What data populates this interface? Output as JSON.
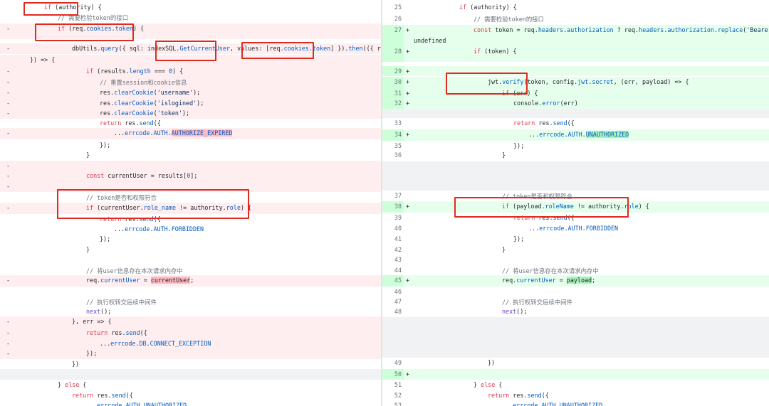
{
  "diff": {
    "left": {
      "rows": [
        {
          "text": "if (authority) {",
          "marker": "",
          "type": "normal"
        },
        {
          "text": "// 需要检验token的接口",
          "marker": "",
          "type": "normal"
        },
        {
          "text": "if (req.cookies.token) {",
          "marker": "-",
          "type": "del"
        },
        {
          "text": "dbUtils.query({ sql: indexSQL.GetCurrentUser, values: [req.cookies.token] }).then(({ results",
          "marker": "-",
          "type": "del"
        },
        {
          "text": "}) => {",
          "marker": "",
          "type": "del"
        },
        {
          "text": "if (results.length === 0) {",
          "marker": "-",
          "type": "del"
        },
        {
          "text": "// 重置session和cookie信息",
          "marker": "-",
          "type": "del"
        },
        {
          "text": "res.clearCookie('username');",
          "marker": "-",
          "type": "del"
        },
        {
          "text": "res.clearCookie('islogined');",
          "marker": "-",
          "type": "del"
        },
        {
          "text": "res.clearCookie('token');",
          "marker": "-",
          "type": "del"
        },
        {
          "text": "return res.send({",
          "marker": "",
          "type": "normal"
        },
        {
          "text": "...errcode.AUTH.AUTHORIZE_EXPIRED",
          "marker": "-",
          "type": "del"
        },
        {
          "text": "});",
          "marker": "",
          "type": "normal"
        },
        {
          "text": "}",
          "marker": "",
          "type": "normal"
        },
        {
          "text": "",
          "marker": "-",
          "type": "del"
        },
        {
          "text": "const currentUser = results[0];",
          "marker": "-",
          "type": "del"
        },
        {
          "text": "",
          "marker": "-",
          "type": "del"
        },
        {
          "text": "// token是否和权限符合",
          "marker": "",
          "type": "normal"
        },
        {
          "text": "if (currentUser.role_name != authority.role) {",
          "marker": "-",
          "type": "del"
        },
        {
          "text": "return res.send({",
          "marker": "",
          "type": "normal"
        },
        {
          "text": "...errcode.AUTH.FORBIDDEN",
          "marker": "",
          "type": "normal"
        },
        {
          "text": "});",
          "marker": "",
          "type": "normal"
        },
        {
          "text": "}",
          "marker": "",
          "type": "normal"
        },
        {
          "text": "",
          "marker": "",
          "type": "normal"
        },
        {
          "text": "// 将user信息存在本次请求内存中",
          "marker": "",
          "type": "normal"
        },
        {
          "text": "req.currentUser = currentUser;",
          "marker": "-",
          "type": "del"
        },
        {
          "text": "",
          "marker": "",
          "type": "normal"
        },
        {
          "text": "// 执行权转交后续中间件",
          "marker": "",
          "type": "normal"
        },
        {
          "text": "next();",
          "marker": "",
          "type": "normal"
        },
        {
          "text": "}, err => {",
          "marker": "-",
          "type": "del"
        },
        {
          "text": "return res.send({",
          "marker": "-",
          "type": "del"
        },
        {
          "text": "...errcode.DB.CONNECT_EXCEPTION",
          "marker": "-",
          "type": "del"
        },
        {
          "text": "});",
          "marker": "-",
          "type": "del"
        },
        {
          "text": "})",
          "marker": "",
          "type": "normal"
        },
        {
          "text": "",
          "marker": "",
          "type": "fill"
        },
        {
          "text": "} else {",
          "marker": "",
          "type": "normal"
        },
        {
          "text": "return res.send({",
          "marker": "",
          "type": "normal"
        },
        {
          "text": "...errcode.AUTH.UNAUTHORIZED",
          "marker": "",
          "type": "normal"
        }
      ]
    },
    "right": {
      "rows": [
        {
          "line": "25",
          "marker": "",
          "text": "if (authority) {",
          "type": "normal"
        },
        {
          "line": "26",
          "marker": "",
          "text": "// 需要检验token的接口",
          "type": "normal"
        },
        {
          "line": "27",
          "marker": "+",
          "text": "const token = req.headers.authorization ? req.headers.authorization.replace('Bearer ', '') :",
          "wrap": "undefined",
          "type": "add"
        },
        {
          "line": "28",
          "marker": "+",
          "text": "if (token) {",
          "type": "add"
        },
        {
          "line": "29",
          "marker": "+",
          "text": "",
          "type": "add"
        },
        {
          "line": "30",
          "marker": "+",
          "text": "jwt.verify(token, config.jwt.secret, (err, payload) => {",
          "type": "add"
        },
        {
          "line": "31",
          "marker": "+",
          "text": "if (err) {",
          "type": "add"
        },
        {
          "line": "32",
          "marker": "+",
          "text": "console.error(err)",
          "type": "add"
        },
        {
          "line": "",
          "marker": "",
          "text": "",
          "type": "fill"
        },
        {
          "line": "33",
          "marker": "",
          "text": "return res.send({",
          "type": "normal"
        },
        {
          "line": "34",
          "marker": "+",
          "text": "...errcode.AUTH.UNAUTHORIZED",
          "type": "add"
        },
        {
          "line": "35",
          "marker": "",
          "text": "});",
          "type": "normal"
        },
        {
          "line": "36",
          "marker": "",
          "text": "}",
          "type": "normal"
        },
        {
          "line": "",
          "marker": "",
          "text": "",
          "type": "fill"
        },
        {
          "line": "37",
          "marker": "",
          "text": "// token是否和权限符合",
          "type": "normal"
        },
        {
          "line": "38",
          "marker": "+",
          "text": "if (payload.roleName != authority.role) {",
          "type": "add"
        },
        {
          "line": "39",
          "marker": "",
          "text": "return res.send({",
          "type": "normal"
        },
        {
          "line": "40",
          "marker": "",
          "text": "...errcode.AUTH.FORBIDDEN",
          "type": "normal"
        },
        {
          "line": "41",
          "marker": "",
          "text": "});",
          "type": "normal"
        },
        {
          "line": "42",
          "marker": "",
          "text": "}",
          "type": "normal"
        },
        {
          "line": "43",
          "marker": "",
          "text": "",
          "type": "normal"
        },
        {
          "line": "44",
          "marker": "",
          "text": "// 将user信息存在本次请求内存中",
          "type": "normal"
        },
        {
          "line": "45",
          "marker": "+",
          "text": "req.currentUser = payload;",
          "type": "add"
        },
        {
          "line": "46",
          "marker": "",
          "text": "",
          "type": "normal"
        },
        {
          "line": "47",
          "marker": "",
          "text": "// 执行权转交后续中间件",
          "type": "normal"
        },
        {
          "line": "48",
          "marker": "",
          "text": "next();",
          "type": "normal"
        },
        {
          "line": "",
          "marker": "",
          "text": "",
          "type": "fill"
        },
        {
          "line": "49",
          "marker": "",
          "text": "})",
          "type": "normal"
        },
        {
          "line": "50",
          "marker": "+",
          "text": "",
          "type": "add"
        },
        {
          "line": "51",
          "marker": "",
          "text": "} else {",
          "type": "normal"
        },
        {
          "line": "52",
          "marker": "",
          "text": "return res.send({",
          "type": "normal"
        },
        {
          "line": "53",
          "marker": "",
          "text": "...errcode.AUTH.UNAUTHORIZED",
          "type": "normal"
        }
      ]
    },
    "colors": {
      "deleted_bg": "#ffeef0",
      "deleted_gutter": "#ffdce0",
      "added_bg": "#e6ffed",
      "added_gutter": "#cdffd8",
      "empty_bg": "#f1f2f4",
      "highlight_box": "#e12a1e"
    }
  }
}
